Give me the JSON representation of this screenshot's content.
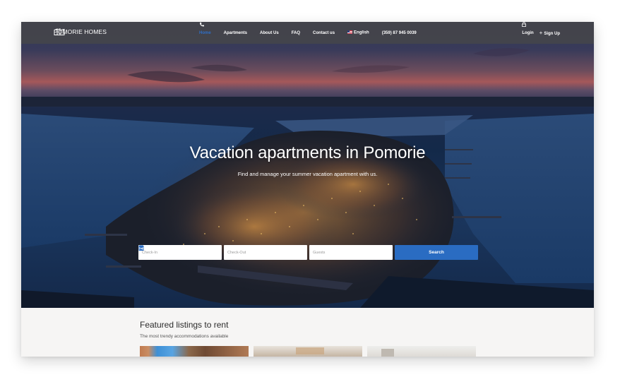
{
  "brand": {
    "name": "POMORIE HOMES",
    "icon": "building-icon"
  },
  "nav": {
    "items": [
      {
        "label": "Home",
        "active": true
      },
      {
        "label": "Apartments",
        "active": false
      },
      {
        "label": "About Us",
        "active": false
      },
      {
        "label": "FAQ",
        "active": false
      },
      {
        "label": "Contact us",
        "active": false
      }
    ],
    "language": "English",
    "phone": "(359) 87 945 0039",
    "login": "Login",
    "signup": "Sign Up"
  },
  "hero": {
    "title": "Vacation apartments in Pomorie",
    "subtitle": "Find and manage your summer vacation apartment with us."
  },
  "search": {
    "checkin_placeholder": "Check-In",
    "checkout_placeholder": "Check-Out",
    "guests_placeholder": "Guests",
    "button_label": "Search"
  },
  "featured": {
    "title": "Featured listings to rent",
    "subtitle": "The most trendy accommodations available"
  },
  "colors": {
    "accent": "#2a6cc2",
    "navbar": "#46464a",
    "active_nav": "#2f6fc6",
    "section_bg": "#f6f5f4"
  }
}
